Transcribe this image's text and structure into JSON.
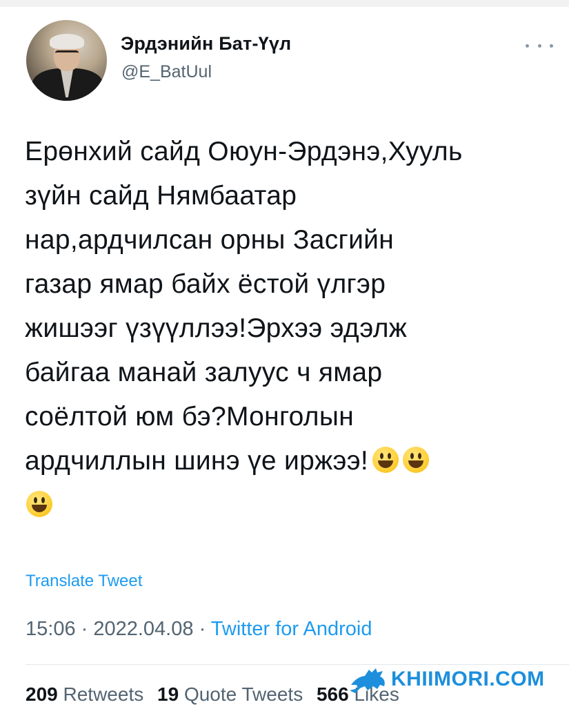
{
  "author": {
    "name": "Эрдэнийн Бат-Үүл",
    "handle": "@E_BatUul"
  },
  "tweet": {
    "text": "Ерөнхий сайд Оюун-Эрдэнэ,Хууль\nзүйн сайд Нямбаатар\nнар,ардчилсан орны Засгийн\nгазар ямар байх ёстой үлгэр\nжишээг үзүүллээ!Эрхээ эдэлж\nбайгаа манай залуус ч ямар\nсоёлтой юм бэ?Монголын\nардчиллын шинэ үе иржээ!",
    "emoji_icons": [
      "grinning-face-icon",
      "grinning-face-icon",
      "grinning-face-icon"
    ]
  },
  "translate_label": "Translate Tweet",
  "meta": {
    "time": "15:06",
    "separator": " · ",
    "date": "2022.04.08",
    "source": "Twitter for Android"
  },
  "stats": {
    "retweets_count": "209",
    "retweets_label": "Retweets",
    "quotes_count": "19",
    "quotes_label": "Quote Tweets",
    "likes_count": "566",
    "likes_label": "Likes"
  },
  "watermark": {
    "text": "KHIIMORI.COM"
  },
  "colors": {
    "link": "#1d9bf0",
    "secondary_text": "#536471",
    "primary_text": "#0f1419"
  }
}
